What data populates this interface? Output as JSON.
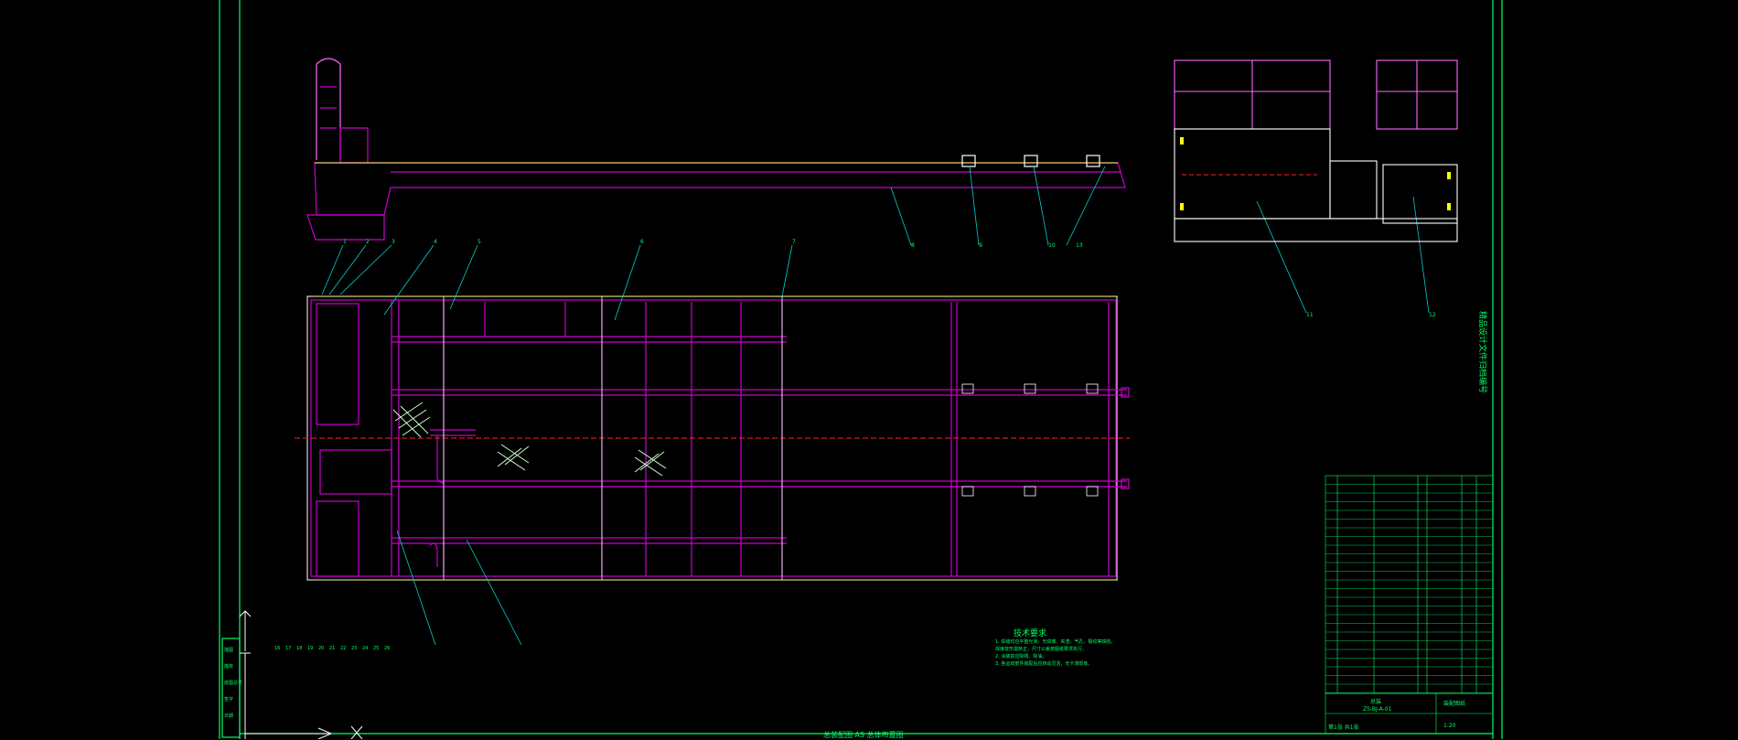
{
  "colors": {
    "background": "#000000",
    "frame": "#00ff66",
    "body": "#cc00cc",
    "outline": "#ffffff",
    "centerline": "#ff2020",
    "leader": "#00d0d0",
    "label": "#ffff00"
  },
  "drawing": {
    "side_title": "精品设计文件归档编号",
    "bottom_caption": "总装配图 AS 总体布置图",
    "notes": {
      "title": "技术要求",
      "items": [
        "1. 焊缝均应平整光滑，无焊瘤、夹渣、气孔、裂纹等缺陷。",
        "   焊接变形需矫正，尺寸公差按图纸要求执行。",
        "2. 涂装前应除锈、除油。",
        "3. 各运动部件装配后应转动灵活，无卡滞现象。"
      ]
    },
    "callouts_top": [
      "1",
      "2",
      "3",
      "4",
      "5",
      "6",
      "7",
      "8",
      "9",
      "10"
    ],
    "callouts_bottom": [
      "16",
      "17",
      "18",
      "19",
      "20",
      "21",
      "22",
      "23",
      "24",
      "25",
      "26"
    ],
    "section_labels": [
      "11",
      "12",
      "13"
    ],
    "title_block": {
      "name": "总装",
      "drawing_no": "ZS-BJ-A-01",
      "company": "装配图纸",
      "scale": "1:20",
      "sheet": "第1张 共1张"
    },
    "left_strip": [
      "描图",
      "描校",
      "底图总号",
      "签字",
      "日期"
    ]
  }
}
